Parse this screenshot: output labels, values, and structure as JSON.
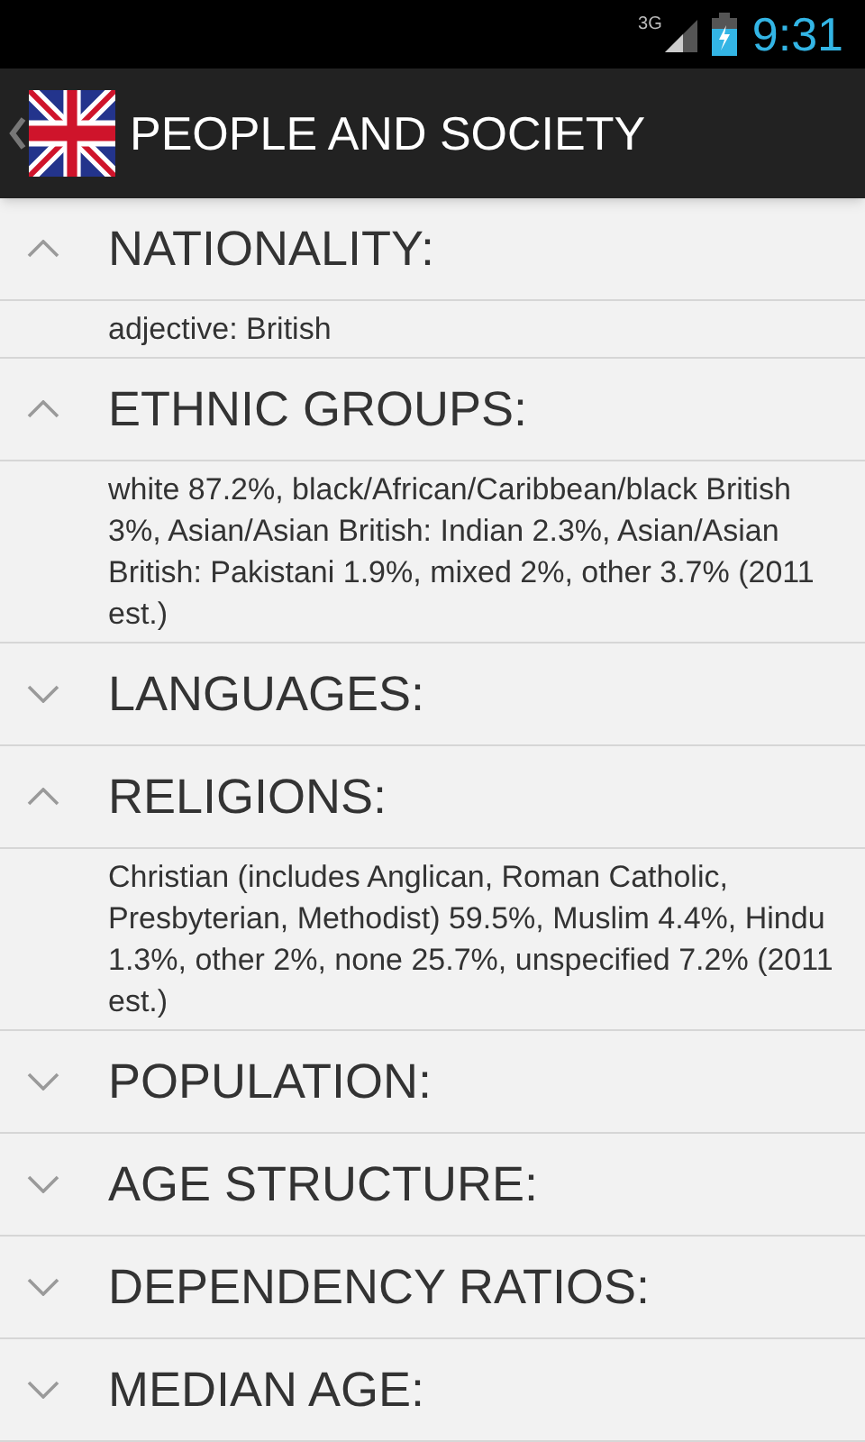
{
  "status_bar": {
    "network": "3G",
    "time": "9:31"
  },
  "action_bar": {
    "title": "PEOPLE AND SOCIETY"
  },
  "sections": [
    {
      "title": "NATIONALITY:",
      "expanded": true,
      "content": "adjective: British"
    },
    {
      "title": "ETHNIC GROUPS:",
      "expanded": true,
      "content": "white 87.2%, black/African/Caribbean/black British 3%, Asian/Asian British: Indian 2.3%, Asian/Asian British: Pakistani 1.9%, mixed 2%, other 3.7% (2011 est.)"
    },
    {
      "title": "LANGUAGES:",
      "expanded": false
    },
    {
      "title": "RELIGIONS:",
      "expanded": true,
      "content": "Christian (includes Anglican, Roman Catholic, Presbyterian, Methodist) 59.5%, Muslim 4.4%, Hindu 1.3%, other 2%, none 25.7%, unspecified 7.2% (2011 est.)"
    },
    {
      "title": "POPULATION:",
      "expanded": false
    },
    {
      "title": "AGE STRUCTURE:",
      "expanded": false
    },
    {
      "title": "DEPENDENCY RATIOS:",
      "expanded": false
    },
    {
      "title": "MEDIAN AGE:",
      "expanded": false
    }
  ]
}
